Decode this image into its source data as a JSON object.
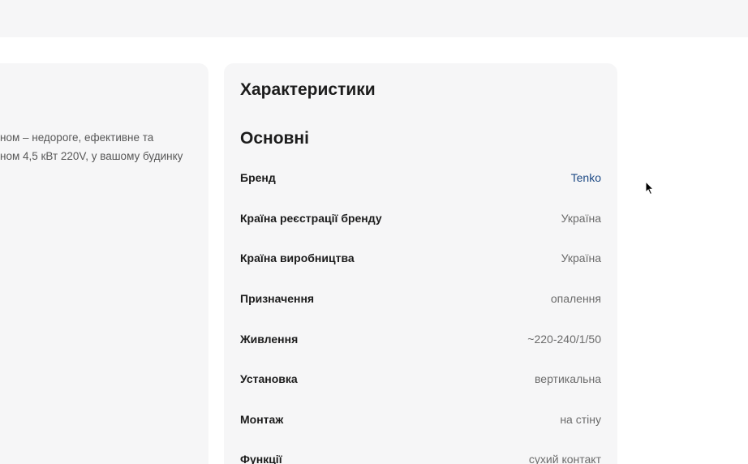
{
  "description": {
    "line1": "ном – недороге, ефективне та",
    "line2": "ном 4,5 кВт 220V, у вашому будинку"
  },
  "specs": {
    "title": "Характеристики",
    "section_title": "Основні",
    "rows": [
      {
        "label": "Бренд",
        "value": "Tenko"
      },
      {
        "label": "Країна реєстрації бренду",
        "value": "Україна"
      },
      {
        "label": "Країна виробництва",
        "value": "Україна"
      },
      {
        "label": "Призначення",
        "value": "опалення"
      },
      {
        "label": "Живлення",
        "value": "~220-240/1/50"
      },
      {
        "label": "Установка",
        "value": "вертикальна"
      },
      {
        "label": "Монтаж",
        "value": "на стіну"
      },
      {
        "label": "Функції",
        "value": "сухий контакт"
      }
    ]
  },
  "colors": {
    "card_bg": "#f6f6f7",
    "link": "#1f4b86",
    "label": "#1c1c1c",
    "value": "#6b6b6b"
  },
  "icons": {
    "cursor": "mouse-pointer-icon"
  }
}
